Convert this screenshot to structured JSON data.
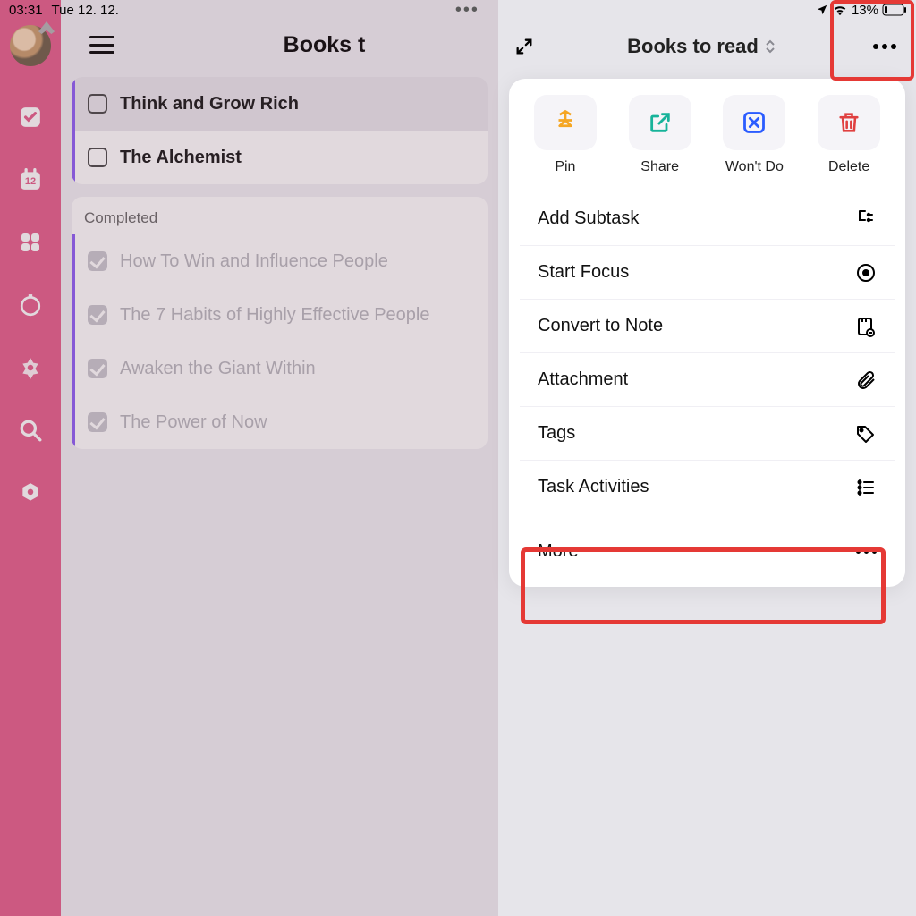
{
  "status": {
    "time": "03:31",
    "date": "Tue 12. 12.",
    "battery": "13%"
  },
  "main": {
    "title": "Books to read",
    "title_truncated": "Books t",
    "completed_label": "Completed",
    "tasks": [
      {
        "label": "Think and Grow Rich",
        "done": false
      },
      {
        "label": "The Alchemist",
        "done": false
      }
    ],
    "completed": [
      {
        "label": "How To Win and Influence People"
      },
      {
        "label": "The 7 Habits of Highly Effective People"
      },
      {
        "label": "Awaken the Giant Within"
      },
      {
        "label": "The Power of Now"
      }
    ]
  },
  "rail": {
    "calendar_badge": "12"
  },
  "panel": {
    "title": "Books to read",
    "actions": [
      {
        "label": "Pin"
      },
      {
        "label": "Share"
      },
      {
        "label": "Won't Do"
      },
      {
        "label": "Delete"
      }
    ],
    "menu": [
      {
        "label": "Add Subtask"
      },
      {
        "label": "Start Focus"
      },
      {
        "label": "Convert to Note"
      },
      {
        "label": "Attachment"
      },
      {
        "label": "Tags"
      },
      {
        "label": "Task Activities"
      }
    ],
    "more_label": "More"
  }
}
